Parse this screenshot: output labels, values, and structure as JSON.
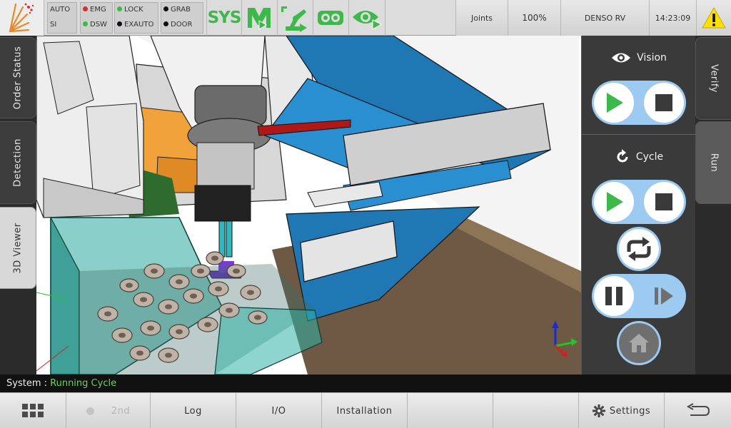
{
  "topbar": {
    "status_left": [
      {
        "label": "AUTO",
        "dot": ""
      },
      {
        "label": "SI",
        "dot": ""
      }
    ],
    "status_mid": [
      {
        "label": "EMG",
        "dot": "#e02a2a"
      },
      {
        "label": "DSW",
        "dot": "#3dbb45"
      }
    ],
    "status_lock": [
      {
        "label": "LOCK",
        "dot": "#3dbb45"
      },
      {
        "label": "EXAUTO",
        "dot": "#111111"
      }
    ],
    "status_grab": [
      {
        "label": "GRAB",
        "dot": "#111111"
      },
      {
        "label": "DOOR",
        "dot": "#111111"
      }
    ],
    "sys_label": "SYS",
    "joints_label": "Joints",
    "speed_label": "100%",
    "robot_label": "DENSO RV",
    "clock": "14:23:09",
    "accent_green": "#3db84a",
    "warning_color": "#ffe000"
  },
  "left_tabs": [
    {
      "label": "Order Status",
      "active": false
    },
    {
      "label": "Detection",
      "active": false
    },
    {
      "label": "3D Viewer",
      "active": true
    }
  ],
  "right_tabs": [
    {
      "label": "Verify",
      "active": false
    },
    {
      "label": "Run",
      "active": true
    }
  ],
  "run_panel": {
    "vision_title": "Vision",
    "cycle_title": "Cycle",
    "pill_color": "#9ccaf0",
    "play_color": "#3db84a"
  },
  "status_bar": {
    "label": "System :",
    "value": "Running Cycle"
  },
  "bottom_bar": {
    "second_label": "2nd",
    "log_label": "Log",
    "io_label": "I/O",
    "installation_label": "Installation",
    "settings_label": "Settings"
  }
}
